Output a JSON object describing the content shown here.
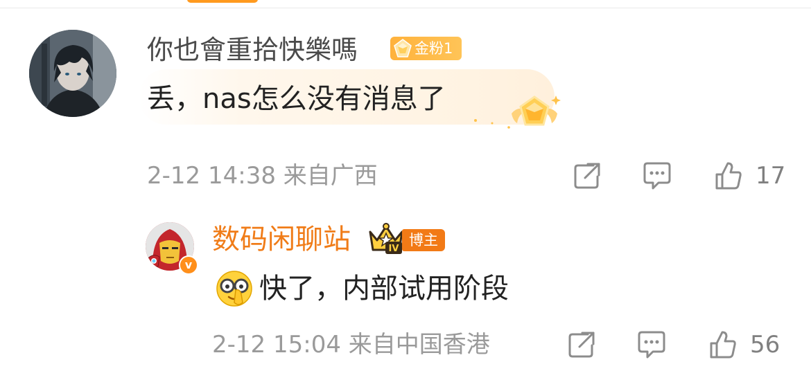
{
  "comment": {
    "username": "你也會重拾快樂嗎",
    "fan_badge": "金粉1",
    "text": "丢，nas怎么没有消息了",
    "time": "2-12 14:38",
    "location": "来自广西",
    "likes": "17"
  },
  "reply": {
    "username": "数码闲聊站",
    "crown_level": "IV",
    "owner_badge": "博主",
    "verify_mark": "v",
    "emoji": "nerd-face-emoji",
    "text": "快了，内部试用阶段",
    "time": "2-12 15:04",
    "location": "来自中国香港",
    "likes": "56"
  },
  "icons": {
    "share": "share-icon",
    "comment": "comment-bubble-icon",
    "like": "thumbs-up-icon"
  },
  "colors": {
    "accent_orange": "#f07c18",
    "badge_gold": "#ffb23c",
    "meta_gray": "#9a9a9a",
    "text_dark": "#222222"
  }
}
